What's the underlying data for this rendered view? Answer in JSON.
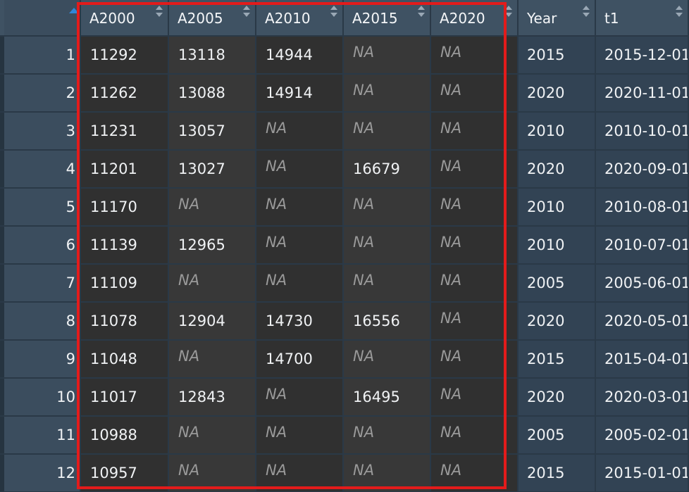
{
  "table": {
    "columns": [
      "A2000",
      "A2005",
      "A2010",
      "A2015",
      "A2020",
      "Year",
      "t1"
    ],
    "rows": [
      {
        "n": "1",
        "cells": [
          "11292",
          "13118",
          "14944",
          "NA",
          "NA",
          "2015",
          "2015-12-01"
        ]
      },
      {
        "n": "2",
        "cells": [
          "11262",
          "13088",
          "14914",
          "NA",
          "NA",
          "2020",
          "2020-11-01"
        ]
      },
      {
        "n": "3",
        "cells": [
          "11231",
          "13057",
          "NA",
          "NA",
          "NA",
          "2010",
          "2010-10-01"
        ]
      },
      {
        "n": "4",
        "cells": [
          "11201",
          "13027",
          "NA",
          "16679",
          "NA",
          "2020",
          "2020-09-01"
        ]
      },
      {
        "n": "5",
        "cells": [
          "11170",
          "NA",
          "NA",
          "NA",
          "NA",
          "2010",
          "2010-08-01"
        ]
      },
      {
        "n": "6",
        "cells": [
          "11139",
          "12965",
          "NA",
          "NA",
          "NA",
          "2010",
          "2010-07-01"
        ]
      },
      {
        "n": "7",
        "cells": [
          "11109",
          "NA",
          "NA",
          "NA",
          "NA",
          "2005",
          "2005-06-01"
        ]
      },
      {
        "n": "8",
        "cells": [
          "11078",
          "12904",
          "14730",
          "16556",
          "NA",
          "2020",
          "2020-05-01"
        ]
      },
      {
        "n": "9",
        "cells": [
          "11048",
          "NA",
          "14700",
          "NA",
          "NA",
          "2015",
          "2015-04-01"
        ]
      },
      {
        "n": "10",
        "cells": [
          "11017",
          "12843",
          "NA",
          "16495",
          "NA",
          "2020",
          "2020-03-01"
        ]
      },
      {
        "n": "11",
        "cells": [
          "10988",
          "NA",
          "NA",
          "NA",
          "NA",
          "2005",
          "2005-02-01"
        ]
      },
      {
        "n": "12",
        "cells": [
          "10957",
          "NA",
          "NA",
          "NA",
          "NA",
          "2015",
          "2015-01-01"
        ]
      }
    ]
  },
  "icons": {
    "sort_ascending": "sort-asc-icon",
    "sort_toggle": "sort-toggle-icon"
  },
  "colors": {
    "highlight": "#e31b1b",
    "sort_active": "#2f87d8",
    "na_text": "#9a9a9a"
  }
}
